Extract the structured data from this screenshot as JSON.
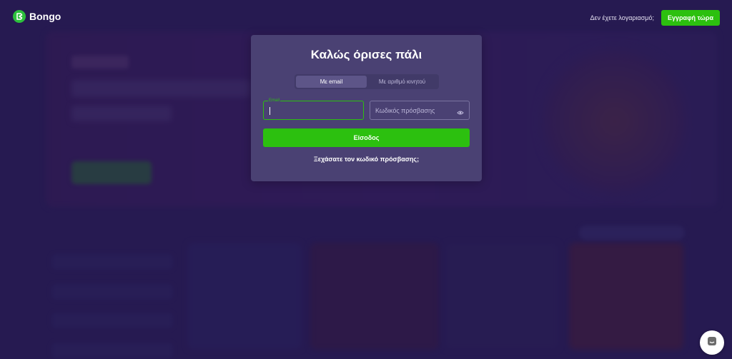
{
  "header": {
    "brand": "Bongo",
    "no_account_text": "Δεν έχετε λογαριασμό;",
    "signup_label": "Εγγραφή τώρα"
  },
  "login": {
    "title": "Καλώς όρισες πάλι",
    "tabs": [
      {
        "label": "Με email",
        "active": true
      },
      {
        "label": "Με αριθμό κινητού",
        "active": false
      }
    ],
    "email_label": "Email",
    "email_value": "",
    "password_placeholder": "Κωδικός πρόσβασης",
    "submit_label": "Είσοδος",
    "forgot_label": "Ξεχάσατε τον κωδικό πρόσβασης;"
  },
  "colors": {
    "accent": "#2cc00f",
    "card": "#4a4173",
    "background": "#2a1f55"
  },
  "icons": [
    "bongo-logo-icon",
    "eye-icon",
    "chat-icon"
  ]
}
